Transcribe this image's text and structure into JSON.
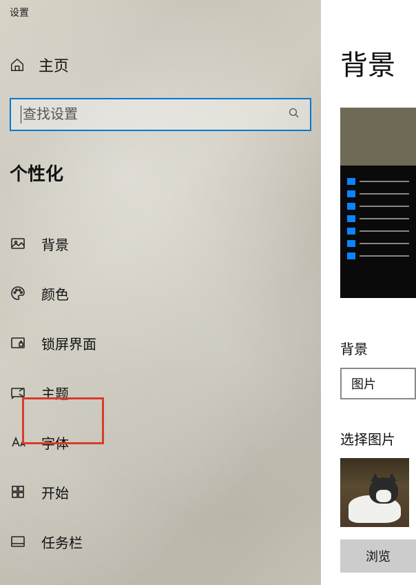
{
  "app_title": "设置",
  "home_label": "主页",
  "search": {
    "placeholder": "查找设置"
  },
  "category_title": "个性化",
  "nav": [
    {
      "id": "background",
      "label": "背景"
    },
    {
      "id": "colors",
      "label": "颜色"
    },
    {
      "id": "lockscreen",
      "label": "锁屏界面"
    },
    {
      "id": "themes",
      "label": "主题"
    },
    {
      "id": "fonts",
      "label": "字体"
    },
    {
      "id": "start",
      "label": "开始"
    },
    {
      "id": "taskbar",
      "label": "任务栏"
    }
  ],
  "main": {
    "title": "背景",
    "bg_section_label": "背景",
    "dropdown_value": "图片",
    "choose_image_label": "选择图片",
    "browse_label": "浏览"
  }
}
